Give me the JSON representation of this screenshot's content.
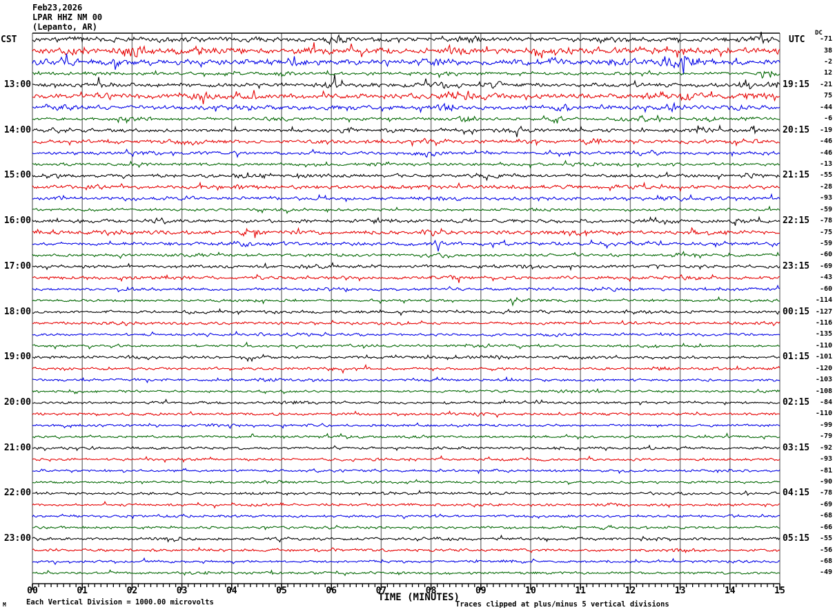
{
  "header": {
    "date": "Feb23,2026",
    "station": "LPAR HHZ NM 00",
    "location": "(Lepanto, AR)",
    "left_tz": "CST",
    "right_tz": "UTC",
    "dc_header": "DC"
  },
  "footer": {
    "scale_note": "Each Vertical Division = 1000.00 microvolts",
    "xaxis_title": "TIME (MINUTES)",
    "clip_note": "Traces clipped at plus/minus 5 vertical divisions",
    "watermark": "M"
  },
  "left_hour_labels": [
    "13:00",
    "14:00",
    "15:00",
    "16:00",
    "17:00",
    "18:00",
    "19:00",
    "20:00",
    "21:00",
    "22:00",
    "23:00"
  ],
  "right_hour_labels": [
    "19:15",
    "20:15",
    "21:15",
    "22:15",
    "23:15",
    "00:15",
    "01:15",
    "02:15",
    "03:15",
    "04:15",
    "05:15"
  ],
  "x_axis": {
    "tick_labels": [
      "00",
      "01",
      "02",
      "03",
      "04",
      "05",
      "06",
      "07",
      "08",
      "09",
      "10",
      "11",
      "12",
      "13",
      "14",
      "15"
    ],
    "minor_per_major": 8
  },
  "chart_data": {
    "type": "line",
    "title": "LPAR HHZ NM 00 (Lepanto, AR) Feb23,2026 helicorder",
    "xlabel": "TIME (MINUTES)",
    "x_range_minutes": [
      0,
      15
    ],
    "rows_per_hour": 4,
    "trace_color_order": [
      "black",
      "red",
      "blue",
      "green"
    ],
    "colors": {
      "black": "#000000",
      "red": "#e60000",
      "blue": "#0000e6",
      "green": "#006600",
      "grid": "#7a7a7a"
    },
    "dc_offsets": [
      -71,
      38,
      -2,
      12,
      -21,
      75,
      -44,
      -6,
      -19,
      -46,
      -46,
      -13,
      -55,
      -28,
      -93,
      -59,
      -78,
      -75,
      -59,
      -60,
      -69,
      -43,
      -60,
      -114,
      -127,
      -116,
      -135,
      -110,
      -101,
      -120,
      -103,
      -108,
      -84,
      -110,
      -99,
      -79,
      -92,
      -93,
      -81,
      -90,
      -78,
      -69,
      -68,
      -66,
      -55,
      -56,
      -68,
      -49
    ],
    "traces": [
      {
        "color": "black",
        "amp": 3.2,
        "bursts": [
          [
            0.9,
            3,
            0.3
          ],
          [
            2.5,
            2,
            0.4
          ],
          [
            5.95,
            7,
            0.06
          ],
          [
            6.1,
            3,
            0.2
          ],
          [
            8.8,
            3,
            0.25
          ],
          [
            11.5,
            2,
            0.3
          ],
          [
            14.6,
            3,
            0.2
          ]
        ]
      },
      {
        "color": "red",
        "amp": 4.2,
        "bursts": [
          [
            0.9,
            4,
            0.25
          ],
          [
            2.1,
            4,
            0.3
          ],
          [
            3.4,
            3,
            0.3
          ],
          [
            5.6,
            4,
            0.25
          ],
          [
            8.6,
            3,
            0.3
          ],
          [
            10.4,
            3,
            0.3
          ],
          [
            12.2,
            3,
            0.3
          ],
          [
            13.9,
            5,
            0.15
          ]
        ]
      },
      {
        "color": "blue",
        "amp": 3.8,
        "bursts": [
          [
            0.6,
            3,
            0.3
          ],
          [
            1.9,
            4,
            0.4
          ],
          [
            5.3,
            2.5,
            0.3
          ],
          [
            8.1,
            2.5,
            0.3
          ],
          [
            10.4,
            3,
            0.3
          ],
          [
            11.7,
            2.5,
            0.3
          ],
          [
            12.7,
            4,
            0.2
          ],
          [
            13.05,
            16,
            0.12
          ],
          [
            13.3,
            6,
            0.2
          ]
        ]
      },
      {
        "color": "green",
        "amp": 2.2,
        "bursts": [
          [
            1.2,
            1.5,
            0.3
          ],
          [
            5.0,
            3,
            0.15
          ],
          [
            8.5,
            1.5,
            0.3
          ],
          [
            14.75,
            4,
            0.12
          ]
        ]
      },
      {
        "color": "black",
        "amp": 2.8,
        "bursts": [
          [
            1.4,
            2.5,
            0.3
          ],
          [
            6.0,
            4,
            0.2
          ],
          [
            7.6,
            2,
            0.3
          ],
          [
            8.3,
            3,
            0.3
          ],
          [
            9.3,
            2,
            0.3
          ],
          [
            14.35,
            6,
            0.12
          ],
          [
            14.9,
            3,
            0.15
          ]
        ]
      },
      {
        "color": "red",
        "amp": 3.6,
        "bursts": [
          [
            1.5,
            3.5,
            0.3
          ],
          [
            3.5,
            3,
            0.3
          ],
          [
            8.45,
            6,
            0.18
          ],
          [
            9.0,
            3,
            0.2
          ],
          [
            12.6,
            3.5,
            0.3
          ],
          [
            13.2,
            3,
            0.2
          ],
          [
            14.5,
            3,
            0.2
          ]
        ]
      },
      {
        "color": "blue",
        "amp": 3.2,
        "bursts": [
          [
            0.5,
            3,
            0.3
          ],
          [
            4.2,
            2,
            0.3
          ],
          [
            8.35,
            4,
            0.2
          ],
          [
            10.65,
            4,
            0.18
          ],
          [
            12.9,
            3.5,
            0.25
          ],
          [
            14.2,
            2,
            0.2
          ]
        ]
      },
      {
        "color": "green",
        "amp": 2.2,
        "bursts": [
          [
            2.0,
            2,
            0.3
          ],
          [
            5.0,
            2,
            0.3
          ],
          [
            8.7,
            4,
            0.25
          ],
          [
            10.55,
            5,
            0.15
          ],
          [
            12.1,
            3.5,
            0.3
          ],
          [
            13.6,
            2,
            0.3
          ]
        ]
      },
      {
        "color": "black",
        "amp": 2.6,
        "bursts": [
          [
            0.4,
            2,
            0.3
          ],
          [
            6.3,
            2,
            0.3
          ],
          [
            9.6,
            2,
            0.3
          ],
          [
            13.4,
            2,
            0.3
          ],
          [
            14.45,
            5,
            0.1
          ]
        ]
      },
      {
        "color": "red",
        "amp": 2.6,
        "bursts": [
          [
            3.1,
            2,
            0.3
          ],
          [
            8.0,
            3,
            0.25
          ],
          [
            9.9,
            2,
            0.3
          ],
          [
            11.3,
            3,
            0.25
          ],
          [
            14.2,
            2,
            0.3
          ]
        ]
      },
      {
        "color": "blue",
        "amp": 2.4,
        "bursts": [
          [
            2.2,
            1.5,
            0.3
          ],
          [
            7.9,
            2.5,
            0.3
          ],
          [
            12.3,
            1.5,
            0.3
          ]
        ]
      },
      {
        "color": "green",
        "amp": 2.1,
        "bursts": [
          [
            2.0,
            1.5,
            0.3
          ],
          [
            6.9,
            1.5,
            0.3
          ],
          [
            11.2,
            1.5,
            0.3
          ]
        ]
      },
      {
        "color": "black",
        "amp": 2.5,
        "bursts": [
          [
            0.3,
            2.5,
            0.2
          ],
          [
            4.4,
            1.5,
            0.3
          ],
          [
            9.0,
            1.5,
            0.3
          ],
          [
            14.4,
            2,
            0.2
          ]
        ]
      },
      {
        "color": "red",
        "amp": 2.7,
        "bursts": [
          [
            1.2,
            2,
            0.3
          ],
          [
            4.3,
            2.5,
            0.25
          ],
          [
            7.8,
            2,
            0.3
          ],
          [
            11.9,
            1.5,
            0.3
          ]
        ]
      },
      {
        "color": "blue",
        "amp": 2.4,
        "bursts": [
          [
            3.0,
            1.5,
            0.3
          ],
          [
            8.2,
            1.5,
            0.3
          ],
          [
            12.8,
            1.5,
            0.3
          ]
        ]
      },
      {
        "color": "green",
        "amp": 2.0,
        "bursts": [
          [
            5.1,
            1.2,
            0.3
          ],
          [
            10.2,
            1.2,
            0.3
          ]
        ]
      },
      {
        "color": "black",
        "amp": 2.6,
        "bursts": [
          [
            2.5,
            1.5,
            0.3
          ],
          [
            7.0,
            1.5,
            0.3
          ],
          [
            14.2,
            2.5,
            0.15
          ]
        ]
      },
      {
        "color": "red",
        "amp": 2.8,
        "bursts": [
          [
            4.4,
            3,
            0.2
          ],
          [
            7.9,
            2.5,
            0.25
          ],
          [
            10.8,
            2,
            0.3
          ],
          [
            13.5,
            2,
            0.3
          ]
        ]
      },
      {
        "color": "blue",
        "amp": 2.6,
        "bursts": [
          [
            4.3,
            2.5,
            0.25
          ],
          [
            8.1,
            2.5,
            0.25
          ],
          [
            12.0,
            1.5,
            0.3
          ]
        ]
      },
      {
        "color": "green",
        "amp": 2.1,
        "bursts": [
          [
            3.2,
            1.2,
            0.3
          ],
          [
            8.2,
            2,
            0.3
          ],
          [
            13.0,
            1.2,
            0.3
          ]
        ]
      },
      {
        "color": "black",
        "amp": 2.3,
        "bursts": [
          [
            5.6,
            1.5,
            0.3
          ],
          [
            9.9,
            1.5,
            0.3
          ]
        ]
      },
      {
        "color": "red",
        "amp": 2.3,
        "bursts": [
          [
            2.8,
            1.5,
            0.3
          ],
          [
            8.4,
            1.5,
            0.3
          ],
          [
            13.2,
            1.5,
            0.3
          ]
        ]
      },
      {
        "color": "blue",
        "amp": 2.2,
        "bursts": [
          [
            6.2,
            1.2,
            0.3
          ],
          [
            11.4,
            1.2,
            0.3
          ]
        ]
      },
      {
        "color": "green",
        "amp": 1.9,
        "bursts": [
          [
            4.4,
            1,
            0.3
          ],
          [
            9.8,
            1,
            0.3
          ]
        ]
      },
      {
        "color": "black",
        "amp": 2.1,
        "bursts": [
          [
            3.3,
            1.2,
            0.3
          ],
          [
            12.2,
            1.2,
            0.3
          ]
        ]
      },
      {
        "color": "red",
        "amp": 2.1,
        "bursts": [
          [
            1.8,
            1.2,
            0.3
          ],
          [
            7.4,
            1.2,
            0.3
          ]
        ]
      },
      {
        "color": "blue",
        "amp": 2.0,
        "bursts": [
          [
            5.5,
            1,
            0.3
          ],
          [
            10.6,
            1,
            0.3
          ]
        ]
      },
      {
        "color": "green",
        "amp": 1.9,
        "bursts": [
          [
            8.8,
            1,
            0.3
          ]
        ]
      },
      {
        "color": "black",
        "amp": 2.1,
        "bursts": [
          [
            2.2,
            1.2,
            0.3
          ],
          [
            9.4,
            1.2,
            0.3
          ]
        ]
      },
      {
        "color": "red",
        "amp": 2.0,
        "bursts": [
          [
            6.1,
            1.2,
            0.3
          ],
          [
            12.7,
            1.2,
            0.3
          ]
        ]
      },
      {
        "color": "blue",
        "amp": 2.0,
        "bursts": [
          [
            4.8,
            1,
            0.3
          ]
        ]
      },
      {
        "color": "green",
        "amp": 1.8,
        "bursts": [
          [
            10.9,
            1,
            0.3
          ]
        ]
      },
      {
        "color": "black",
        "amp": 1.9,
        "bursts": [
          [
            5.2,
            1,
            0.3
          ]
        ]
      },
      {
        "color": "red",
        "amp": 1.9,
        "bursts": [
          [
            8.9,
            1.2,
            0.3
          ]
        ]
      },
      {
        "color": "blue",
        "amp": 1.9,
        "bursts": [
          [
            3.7,
            1,
            0.3
          ]
        ]
      },
      {
        "color": "green",
        "amp": 1.8,
        "bursts": [
          [
            7.7,
            1,
            0.3
          ]
        ]
      },
      {
        "color": "black",
        "amp": 1.9,
        "bursts": [
          [
            1.1,
            1.5,
            0.2
          ],
          [
            10.3,
            1,
            0.3
          ]
        ]
      },
      {
        "color": "red",
        "amp": 1.9,
        "bursts": [
          [
            6.6,
            1.2,
            0.3
          ]
        ]
      },
      {
        "color": "blue",
        "amp": 1.8,
        "bursts": [
          [
            9.1,
            1,
            0.3
          ]
        ]
      },
      {
        "color": "green",
        "amp": 1.8,
        "bursts": [
          [
            4.9,
            1,
            0.3
          ]
        ]
      },
      {
        "color": "black",
        "amp": 1.9,
        "bursts": [
          [
            7.2,
            1,
            0.3
          ]
        ]
      },
      {
        "color": "red",
        "amp": 1.9,
        "bursts": [
          [
            11.6,
            1.2,
            0.3
          ]
        ]
      },
      {
        "color": "blue",
        "amp": 1.8,
        "bursts": [
          [
            2.9,
            1,
            0.3
          ]
        ]
      },
      {
        "color": "green",
        "amp": 1.8,
        "bursts": [
          [
            11.3,
            2,
            0.25
          ]
        ]
      },
      {
        "color": "black",
        "amp": 2.1,
        "bursts": [
          [
            2.8,
            2,
            0.2
          ],
          [
            8.3,
            1,
            0.3
          ]
        ]
      },
      {
        "color": "red",
        "amp": 2.0,
        "bursts": [
          [
            5.9,
            1.2,
            0.3
          ],
          [
            13.1,
            1.2,
            0.3
          ]
        ]
      },
      {
        "color": "blue",
        "amp": 1.9,
        "bursts": [
          [
            9.6,
            1,
            0.3
          ]
        ]
      },
      {
        "color": "green",
        "amp": 1.8,
        "bursts": [
          [
            3.4,
            1,
            0.3
          ]
        ]
      }
    ]
  }
}
